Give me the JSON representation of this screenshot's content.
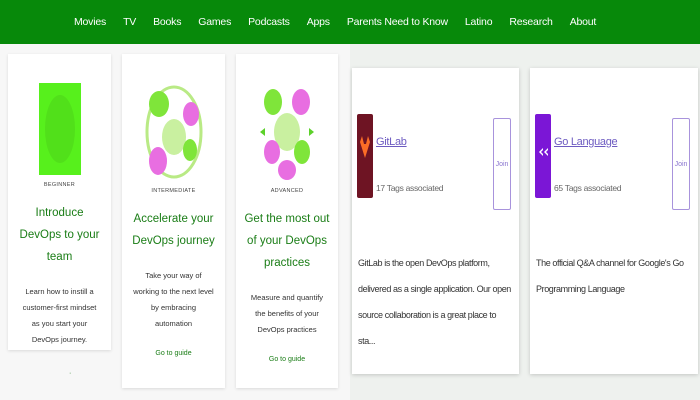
{
  "nav": {
    "items": [
      "Movies",
      "TV",
      "Books",
      "Games",
      "Podcasts",
      "Apps",
      "Parents Need to Know",
      "Latino",
      "Research",
      "About"
    ]
  },
  "cards": [
    {
      "level": "BEGINNER",
      "title": "Introduce DevOps to your team",
      "description": "Learn how to instill a customer-first mindset as you start your DevOps journey.",
      "guide": ""
    },
    {
      "level": "INTERMEDIATE",
      "title": "Accelerate your DevOps journey",
      "description": "Take your way of working to the next level by embracing automation",
      "guide": "Go to guide"
    },
    {
      "level": "ADVANCED",
      "title": "Get the most out of your DevOps practices",
      "description": "Measure and quantify the benefits of your DevOps practices",
      "guide": "Go to guide"
    }
  ],
  "left_footer": "·",
  "groups": [
    {
      "name": "GitLab",
      "tags": "17 Tags associated",
      "join": "Join",
      "description": "GitLab is the open DevOps platform, delivered as a single application. Our open source collaboration is a great place to sta...",
      "logo_color": "#6e1423",
      "logo_icon": "gitlab-logo-icon"
    },
    {
      "name": "Go Language",
      "tags": "65 Tags associated",
      "join": "Join",
      "description": "The official Q&A channel for Google's Go Programming Language",
      "logo_color": "#7b16d6",
      "logo_icon": "go-logo-icon"
    }
  ],
  "colors": {
    "nav_bg": "#07890a",
    "accent_green": "#1a7d16",
    "link_purple": "#6d5bc1"
  }
}
